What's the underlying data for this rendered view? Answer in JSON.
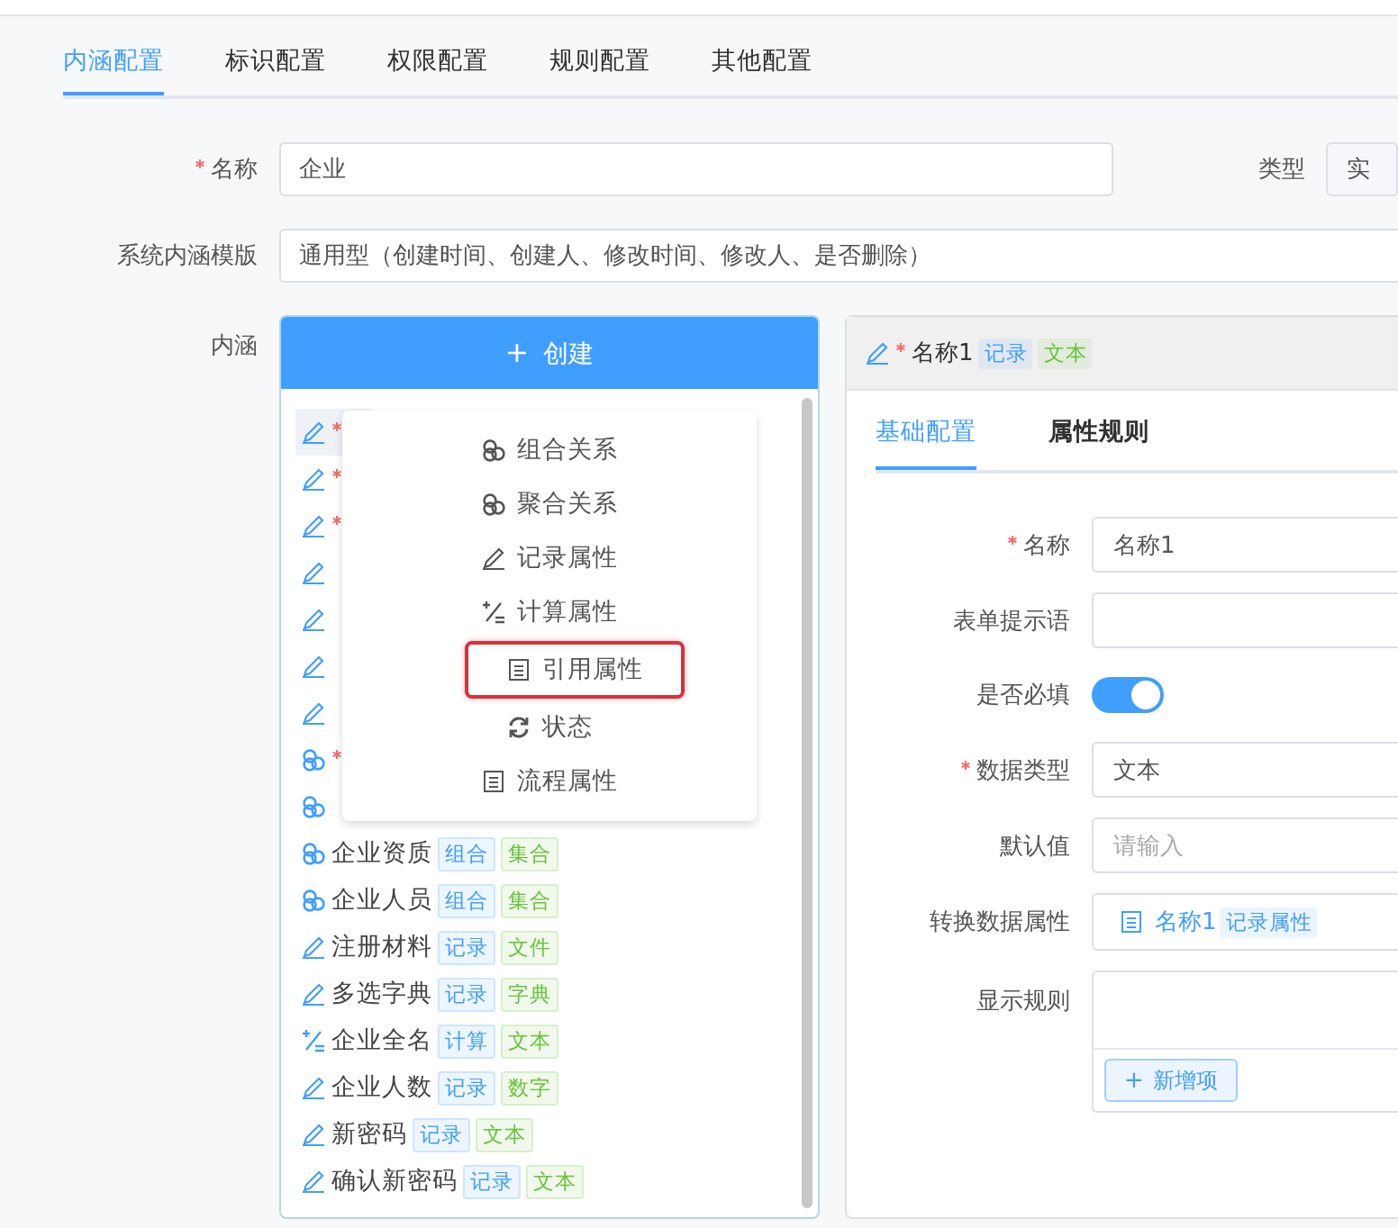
{
  "tabs": [
    {
      "label": "内涵配置",
      "selected": true
    },
    {
      "label": "标识配置",
      "selected": false
    },
    {
      "label": "权限配置",
      "selected": false
    },
    {
      "label": "规则配置",
      "selected": false
    },
    {
      "label": "其他配置",
      "selected": false
    }
  ],
  "name_field": {
    "label": "名称",
    "required": true,
    "value": "企业"
  },
  "type_field": {
    "label": "类型",
    "value": "实"
  },
  "template_field": {
    "label": "系统内涵模版",
    "value": "通用型（创建时间、创建人、修改时间、修改人、是否删除）"
  },
  "content_label": "内涵",
  "create_button": {
    "icon": "+",
    "label": "创建"
  },
  "items": [
    {
      "kind": "edit",
      "required": true,
      "selected": true
    },
    {
      "kind": "edit",
      "required": true,
      "selected": false
    },
    {
      "kind": "edit",
      "required": true,
      "selected": false
    },
    {
      "kind": "edit",
      "required": false,
      "selected": false
    },
    {
      "kind": "edit",
      "required": false,
      "selected": false
    },
    {
      "kind": "edit",
      "required": false,
      "selected": false
    },
    {
      "kind": "edit",
      "required": false,
      "selected": false
    },
    {
      "kind": "relation",
      "required": true,
      "selected": false
    },
    {
      "kind": "relation",
      "required": false,
      "selected": false
    },
    {
      "kind": "relation",
      "required": false,
      "selected": false,
      "name": "企业资质",
      "tags": [
        {
          "text": "组合",
          "color": "#409eff"
        },
        {
          "text": "集合",
          "color": "#67c23a"
        }
      ]
    },
    {
      "kind": "relation",
      "required": false,
      "selected": false,
      "name": "企业人员",
      "tags": [
        {
          "text": "组合",
          "color": "#409eff"
        },
        {
          "text": "集合",
          "color": "#67c23a"
        }
      ]
    },
    {
      "kind": "edit",
      "required": false,
      "selected": false,
      "name": "注册材料",
      "tags": [
        {
          "text": "记录",
          "color": "#409eff"
        },
        {
          "text": "文件",
          "color": "#67c23a"
        }
      ]
    },
    {
      "kind": "edit",
      "required": false,
      "selected": false,
      "name": "多选字典",
      "tags": [
        {
          "text": "记录",
          "color": "#409eff"
        },
        {
          "text": "字典",
          "color": "#67c23a"
        }
      ]
    },
    {
      "kind": "calc",
      "required": false,
      "selected": false,
      "name": "企业全名",
      "tags": [
        {
          "text": "计算",
          "color": "#409eff"
        },
        {
          "text": "文本",
          "color": "#67c23a"
        }
      ]
    },
    {
      "kind": "edit",
      "required": false,
      "selected": false,
      "name": "企业人数",
      "tags": [
        {
          "text": "记录",
          "color": "#409eff"
        },
        {
          "text": "数字",
          "color": "#67c23a"
        }
      ]
    },
    {
      "kind": "edit",
      "required": false,
      "selected": false,
      "name": "新密码",
      "tags": [
        {
          "text": "记录",
          "color": "#409eff"
        },
        {
          "text": "文本",
          "color": "#67c23a"
        }
      ]
    },
    {
      "kind": "edit",
      "required": false,
      "selected": false,
      "name": "确认新密码",
      "tags": [
        {
          "text": "记录",
          "color": "#409eff"
        },
        {
          "text": "文本",
          "color": "#67c23a"
        }
      ]
    }
  ],
  "menu": [
    {
      "kind": "relation",
      "label": "组合关系",
      "highlighted": false
    },
    {
      "kind": "relation",
      "label": "聚合关系",
      "highlighted": false
    },
    {
      "kind": "edit",
      "label": "记录属性",
      "highlighted": false
    },
    {
      "kind": "calc",
      "label": "计算属性",
      "highlighted": false
    },
    {
      "kind": "doc",
      "label": "引用属性",
      "highlighted": true
    },
    {
      "kind": "sync",
      "label": "状态",
      "highlighted": false
    },
    {
      "kind": "doc",
      "label": "流程属性",
      "highlighted": false
    }
  ],
  "detail": {
    "header": {
      "kind": "edit",
      "required": true,
      "name": "名称1",
      "tags": [
        {
          "text": "记录",
          "color": "#409eff"
        },
        {
          "text": "文本",
          "color": "#67c23a"
        }
      ]
    },
    "tabs": [
      {
        "label": "基础配置",
        "selected": true
      },
      {
        "label": "属性规则",
        "selected": false
      }
    ],
    "fields": [
      {
        "kind": "input",
        "label": "名称",
        "required": true,
        "value": "名称1"
      },
      {
        "kind": "input",
        "label": "表单提示语",
        "required": false
      },
      {
        "kind": "switch",
        "label": "是否必填",
        "required": false,
        "on": true
      },
      {
        "kind": "input",
        "label": "数据类型",
        "required": true,
        "value": "文本"
      },
      {
        "kind": "input",
        "label": "默认值",
        "required": false,
        "placeholder": "请输入"
      },
      {
        "kind": "ref",
        "label": "转换数据属性",
        "required": false,
        "value": "名称1",
        "tag": "记录属性"
      },
      {
        "kind": "rules",
        "label": "显示规则",
        "required": false,
        "button": "新增项",
        "button_icon": "+"
      }
    ]
  }
}
